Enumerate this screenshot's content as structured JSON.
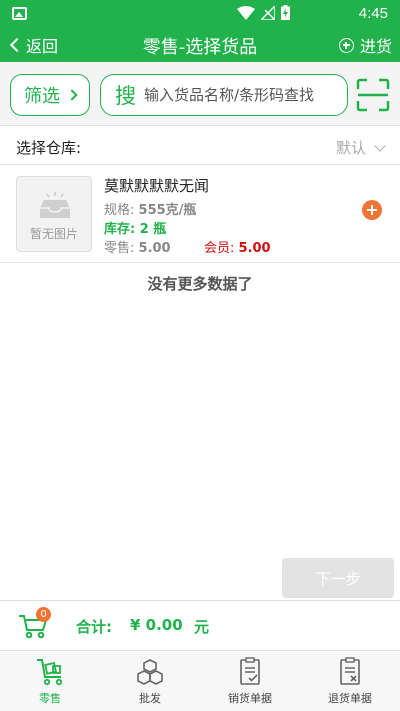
{
  "status_bar": {
    "time": "4:45"
  },
  "header": {
    "back_label": "返回",
    "title": "零售-选择货品",
    "action_label": "进货"
  },
  "search": {
    "filter_label": "筛选",
    "search_label": "搜",
    "placeholder": "输入货品名称/条形码查找"
  },
  "warehouse": {
    "label": "选择仓库:",
    "value": "默认"
  },
  "products": [
    {
      "image_text": "暂无图片",
      "name": "莫默默默默无闻",
      "spec_label": "规格:",
      "spec_value": "555克/瓶",
      "stock_label": "库存:",
      "stock_value": "2 瓶",
      "retail_label": "零售:",
      "retail_value": "5.00",
      "member_label": "会员:",
      "member_value": "5.00"
    }
  ],
  "list_end_text": "没有更多数据了",
  "next_button": "下一步",
  "cart": {
    "count": "0",
    "total_label": "合计:",
    "total_amount": "¥ 0.00",
    "total_unit": "元"
  },
  "bottom_nav": [
    {
      "label": "零售",
      "icon": "retail-cart-icon",
      "active": true
    },
    {
      "label": "批发",
      "icon": "wholesale-boxes-icon",
      "active": false
    },
    {
      "label": "销货单据",
      "icon": "sales-doc-icon",
      "active": false
    },
    {
      "label": "退货单据",
      "icon": "return-doc-icon",
      "active": false
    }
  ],
  "colors": {
    "primary": "#22b24c",
    "accent": "#f07534",
    "member_price": "#d01010"
  }
}
